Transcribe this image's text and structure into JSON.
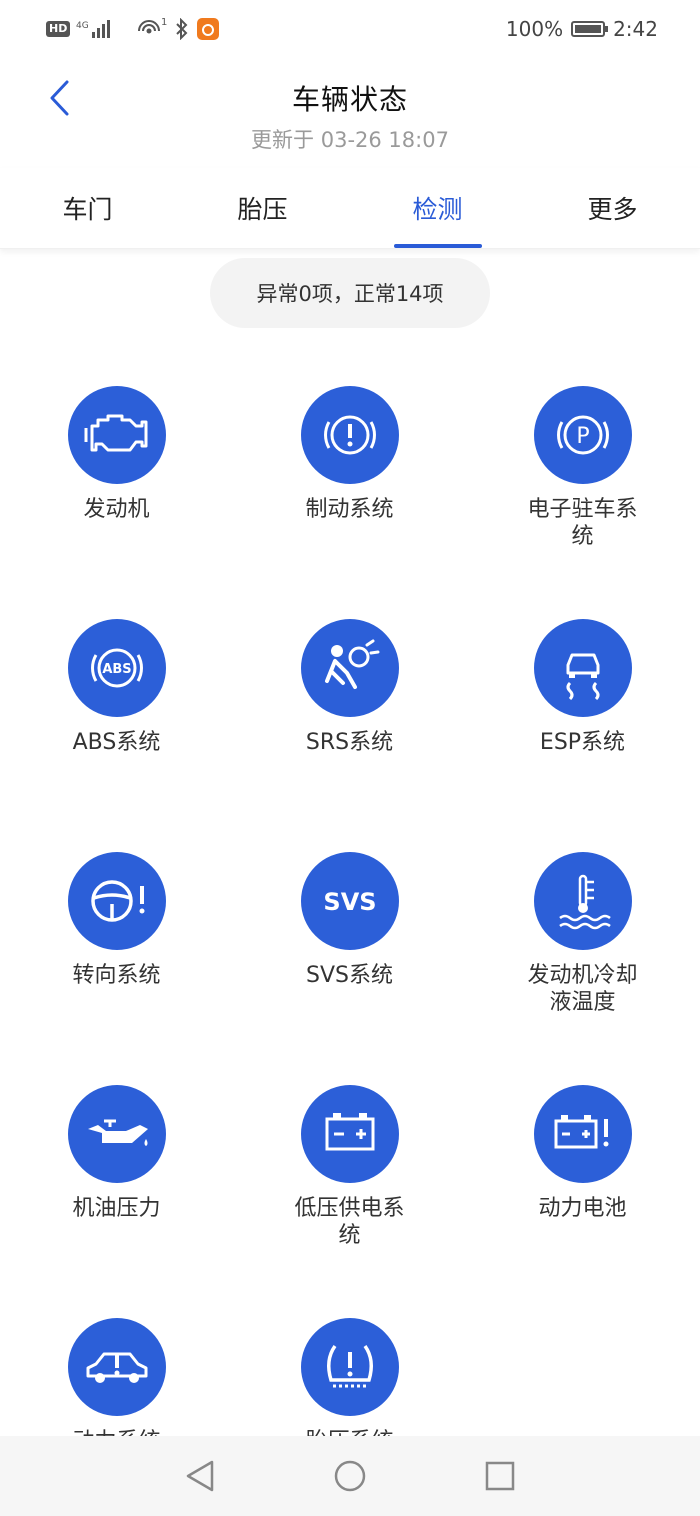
{
  "status_bar": {
    "hd": "HD",
    "network": "4G",
    "hotspot_count": "1",
    "battery_percent": "100%",
    "time": "2:42"
  },
  "header": {
    "title": "车辆状态",
    "subtitle": "更新于 03-26 18:07",
    "back_icon": "chevron-left-icon"
  },
  "tabs": [
    {
      "label": "车门",
      "active": false
    },
    {
      "label": "胎压",
      "active": false
    },
    {
      "label": "检测",
      "active": true
    },
    {
      "label": "更多",
      "active": false
    }
  ],
  "summary": "异常0项，正常14项",
  "items": [
    {
      "label": "发动机",
      "icon": "engine-icon"
    },
    {
      "label": "制动系统",
      "icon": "brake-warning-icon"
    },
    {
      "label": "电子驻车系统",
      "icon": "parking-brake-icon"
    },
    {
      "label": "ABS系统",
      "icon": "abs-icon"
    },
    {
      "label": "SRS系统",
      "icon": "airbag-icon"
    },
    {
      "label": "ESP系统",
      "icon": "esp-skid-icon"
    },
    {
      "label": "转向系统",
      "icon": "steering-warning-icon"
    },
    {
      "label": "SVS系统",
      "icon": "svs-icon",
      "icon_text": "SVS"
    },
    {
      "label": "发动机冷却液温度",
      "icon": "coolant-temperature-icon"
    },
    {
      "label": "机油压力",
      "icon": "oil-pressure-icon"
    },
    {
      "label": "低压供电系统",
      "icon": "battery-icon"
    },
    {
      "label": "动力电池",
      "icon": "power-battery-warning-icon"
    },
    {
      "label": "动力系统",
      "icon": "powertrain-warning-icon"
    },
    {
      "label": "胎压系统",
      "icon": "tire-pressure-icon"
    }
  ],
  "icon_text": {
    "abs": "ABS",
    "svs": "SVS",
    "parking": "P"
  },
  "colors": {
    "accent": "#2a5bd7",
    "icon_bg": "#2c5fd8",
    "subtle_text": "#9a9a9a",
    "pill_bg": "#f3f3f3"
  },
  "nav": {
    "back": "triangle-back-icon",
    "home": "circle-home-icon",
    "recent": "square-recent-icon"
  }
}
